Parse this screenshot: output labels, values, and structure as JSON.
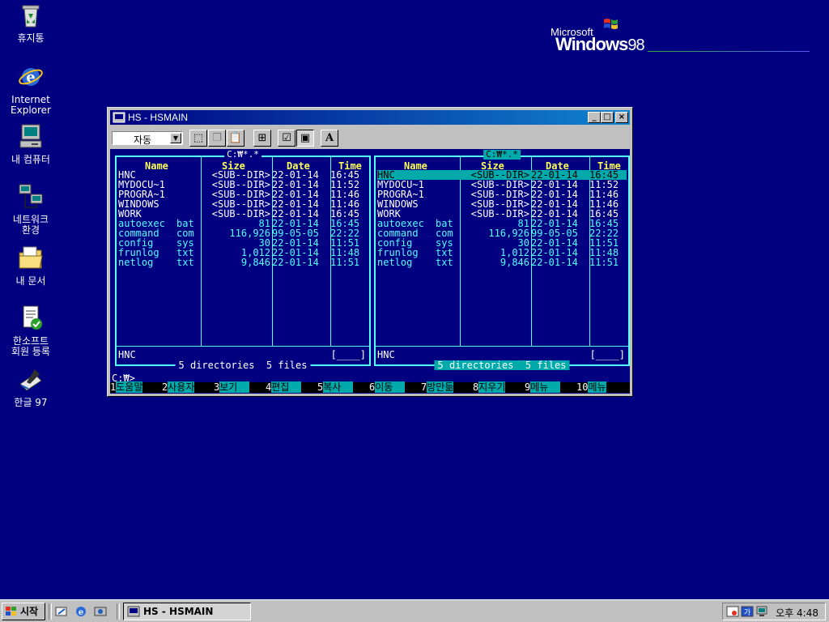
{
  "desktop": {
    "icons": [
      {
        "label": "휴지통",
        "icon": "recycle-bin-icon"
      },
      {
        "label": "Internet\nExplorer",
        "icon": "internet-explorer-icon"
      },
      {
        "label": "내 컴퓨터",
        "icon": "my-computer-icon"
      },
      {
        "label": "네트워크\n환경",
        "icon": "network-icon"
      },
      {
        "label": "내 문서",
        "icon": "my-documents-icon"
      },
      {
        "label": "한소프트\n회원 등록",
        "icon": "hansoft-register-icon"
      },
      {
        "label": "한글 97",
        "icon": "hangul97-icon"
      }
    ],
    "logo": {
      "microsoft": "Microsoft",
      "windows": "Windows",
      "version": "98"
    }
  },
  "window": {
    "title": "HS - HSMAIN",
    "toolbar": {
      "font_select": "자동"
    },
    "left_panel": {
      "path": "C:₩*.*",
      "headers": {
        "name": "Name",
        "size": "Size",
        "date": "Date",
        "time": "Time"
      },
      "current": "HNC",
      "box": "[____]",
      "summary": "5 directories  5 files"
    },
    "right_panel": {
      "path": "C:₩*.*",
      "headers": {
        "name": "Name",
        "size": "Size",
        "date": "Date",
        "time": "Time"
      },
      "current": "HNC",
      "box": "[____]",
      "summary": "5 directories  5 files"
    },
    "files": [
      {
        "name": "HNC",
        "ext": "",
        "size": "<SUB--DIR>",
        "date": "22-01-14",
        "time": "16:45"
      },
      {
        "name": "MYDOCU~1",
        "ext": "",
        "size": "<SUB--DIR>",
        "date": "22-01-14",
        "time": "11:52"
      },
      {
        "name": "PROGRA~1",
        "ext": "",
        "size": "<SUB--DIR>",
        "date": "22-01-14",
        "time": "11:46"
      },
      {
        "name": "WINDOWS",
        "ext": "",
        "size": "<SUB--DIR>",
        "date": "22-01-14",
        "time": "11:46"
      },
      {
        "name": "WORK",
        "ext": "",
        "size": "<SUB--DIR>",
        "date": "22-01-14",
        "time": "16:45"
      },
      {
        "name": "autoexec",
        "ext": "bat",
        "size": "81",
        "date": "22-01-14",
        "time": "16:45"
      },
      {
        "name": "command",
        "ext": "com",
        "size": "116,926",
        "date": "99-05-05",
        "time": "22:22"
      },
      {
        "name": "config",
        "ext": "sys",
        "size": "30",
        "date": "22-01-14",
        "time": "11:51"
      },
      {
        "name": "frunlog",
        "ext": "txt",
        "size": "1,012",
        "date": "22-01-14",
        "time": "11:48"
      },
      {
        "name": "netlog",
        "ext": "txt",
        "size": "9,846",
        "date": "22-01-14",
        "time": "11:51"
      }
    ],
    "prompt": "C:₩>_",
    "fkeys": [
      {
        "num": "1",
        "label": "도움말"
      },
      {
        "num": "2",
        "label": "사용자"
      },
      {
        "num": "3",
        "label": "보기  "
      },
      {
        "num": "4",
        "label": "편집  "
      },
      {
        "num": "5",
        "label": "복사  "
      },
      {
        "num": "6",
        "label": "이동  "
      },
      {
        "num": "7",
        "label": "방만듦"
      },
      {
        "num": "8",
        "label": "지우기"
      },
      {
        "num": "9",
        "label": "메뉴  "
      },
      {
        "num": "10",
        "label": "메뉴"
      }
    ]
  },
  "taskbar": {
    "start_label": "시작",
    "task_title": "HS - HSMAIN",
    "clock": "오후 4:48"
  }
}
